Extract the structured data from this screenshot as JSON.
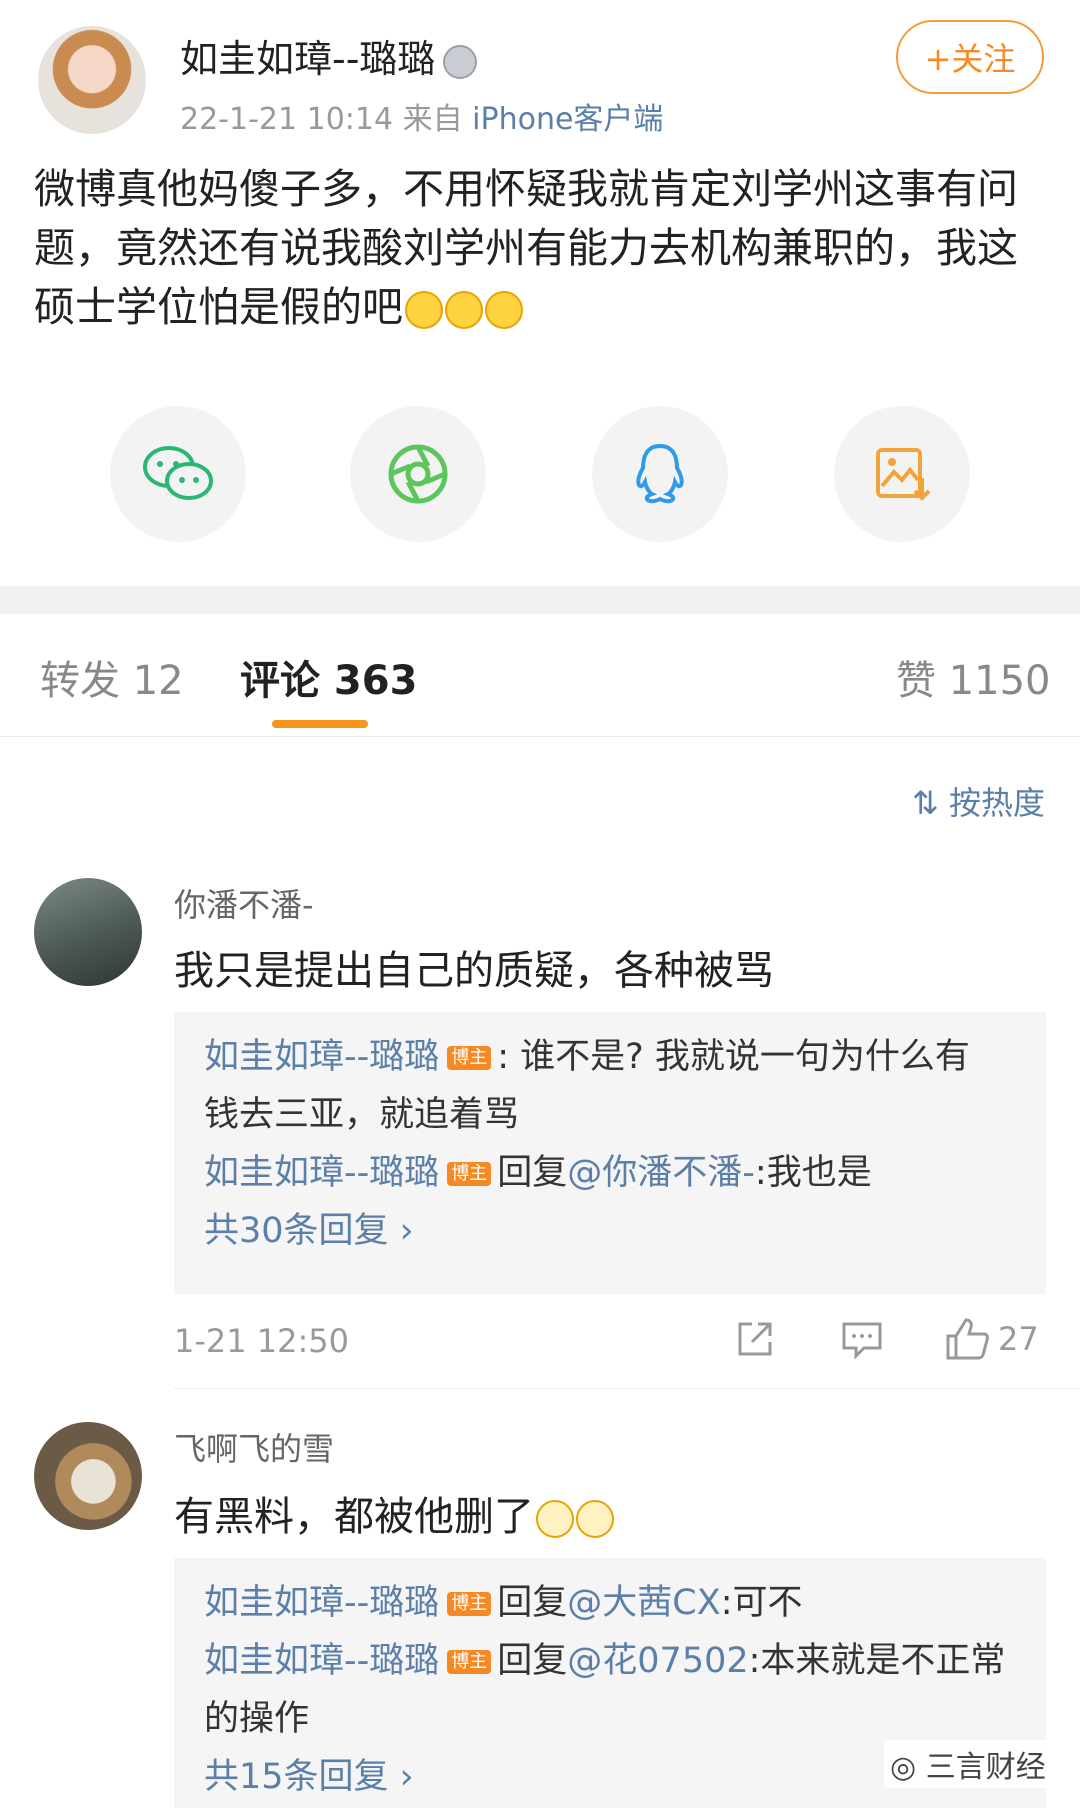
{
  "post": {
    "author": "如圭如璋--璐璐",
    "time": "22-1-21 10:14",
    "source_prefix": "来自",
    "source": "iPhone客户端",
    "follow_label": "+关注",
    "text": "微博真他妈傻子多，不用怀疑我就肯定刘学州这事有问题，竟然还有说我酸刘学州有能力去机构兼职的，我这硕士学位怕是假的吧"
  },
  "share": {
    "icons": [
      "wechat-icon",
      "moments-icon",
      "qq-icon",
      "save-image-icon"
    ]
  },
  "tabs": {
    "repost": "转发 12",
    "comments": "评论 363",
    "likes": "赞 1150"
  },
  "sort_label": "按热度",
  "comments": [
    {
      "name": "你潘不潘-",
      "text": "我只是提出自己的质疑，各种被骂",
      "replies": [
        {
          "who": "如圭如璋--璐璐",
          "badge": "博主",
          "body_a": ": 谁不是? 我就说一句为什么有",
          "body_b": "钱去三亚，就追着骂"
        },
        {
          "who": "如圭如璋--璐璐",
          "badge": "博主",
          "reply_word": "回复",
          "at": "@你潘不潘-",
          "body": ":我也是"
        }
      ],
      "more": "共30条回复 ›",
      "time": "1-21 12:50",
      "likes": "27"
    },
    {
      "name": "飞啊飞的雪",
      "text": "有黑料，都被他删了",
      "replies": [
        {
          "who": "如圭如璋--璐璐",
          "badge": "博主",
          "reply_word": "回复",
          "at": "@大茜CX",
          "body": ":可不"
        },
        {
          "who": "如圭如璋--璐璐",
          "badge": "博主",
          "reply_word": "回复",
          "at": "@花07502",
          "body": ":本来就是不正常",
          "body_b": "的操作"
        }
      ],
      "more": "共15条回复 ›"
    }
  ],
  "watermark": "三言财经",
  "colors": {
    "accent": "#f58a24",
    "link": "#5b7fa8"
  }
}
